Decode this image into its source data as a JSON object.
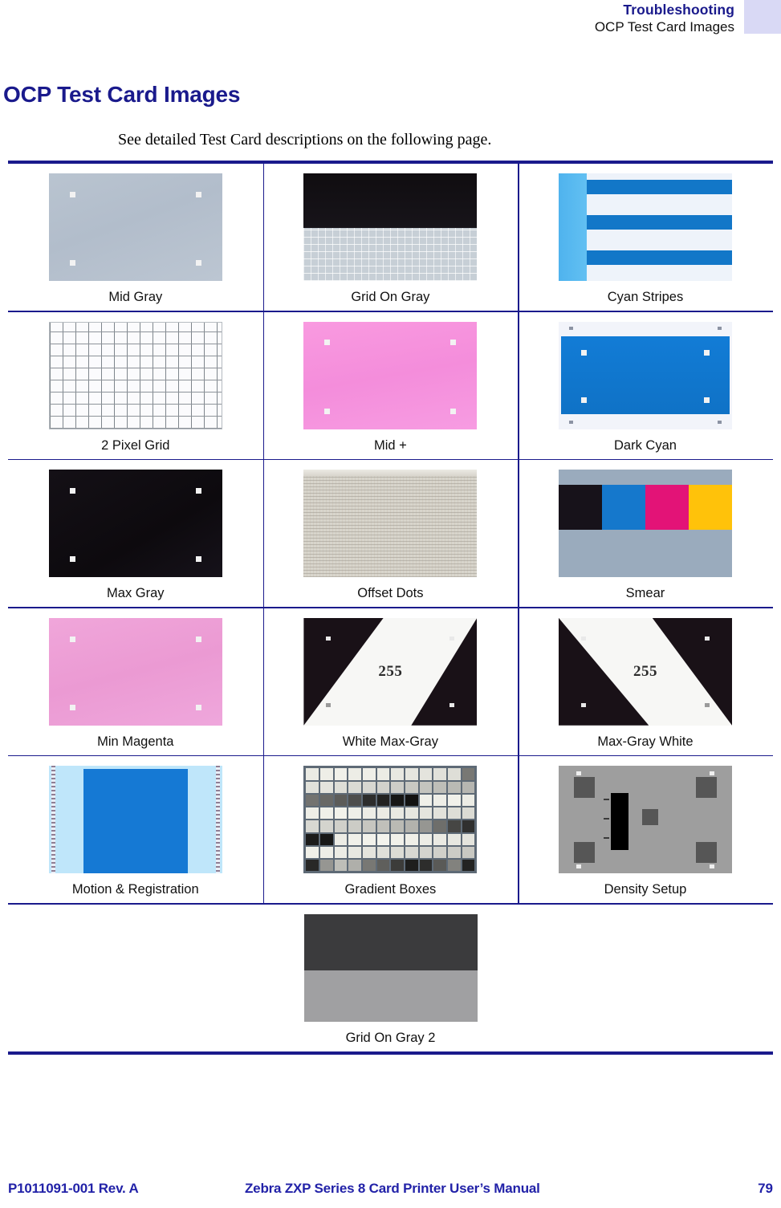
{
  "header": {
    "chapter": "Troubleshooting",
    "section": "OCP Test Card Images"
  },
  "page_title": "OCP Test Card Images",
  "intro": "See detailed Test Card descriptions on the following page.",
  "table": {
    "rows": [
      [
        {
          "caption": "Mid Gray",
          "art": "midgray"
        },
        {
          "caption": "Grid On Gray",
          "art": "gridongray"
        },
        {
          "caption": "Cyan Stripes",
          "art": "cyanstripes"
        }
      ],
      [
        {
          "caption": "2 Pixel Grid",
          "art": "2pxgrid"
        },
        {
          "caption": "Mid +",
          "art": "midplus"
        },
        {
          "caption": "Dark Cyan",
          "art": "darkcyan"
        }
      ],
      [
        {
          "caption": "Max Gray",
          "art": "maxgray"
        },
        {
          "caption": "Offset Dots",
          "art": "offsetdots"
        },
        {
          "caption": "Smear",
          "art": "smear"
        }
      ],
      [
        {
          "caption": "Min Magenta",
          "art": "minmagenta"
        },
        {
          "caption": "White Max-Gray",
          "art": "whitemaxgray",
          "value": "255"
        },
        {
          "caption": "Max-Gray White",
          "art": "maxgraywhite",
          "value": "255"
        }
      ],
      [
        {
          "caption": "Motion & Registration",
          "art": "motion"
        },
        {
          "caption": "Gradient Boxes",
          "art": "gradboxes"
        },
        {
          "caption": "Density Setup",
          "art": "density"
        }
      ],
      [
        {
          "caption": "Grid On Gray 2",
          "art": "gridongray2"
        }
      ]
    ]
  },
  "smear_blocks": [
    "#17121a",
    "#1578cc",
    "#e31377",
    "#ffc20a"
  ],
  "colors": {
    "rule": "#1a1a8c",
    "heading": "#1a1a8c",
    "footer_text": "#2222a8",
    "header_tab": "#d9d9f5"
  },
  "footer": {
    "part_number": "P1011091-001 Rev. A",
    "manual_title": "Zebra ZXP Series 8 Card Printer User’s Manual",
    "page_number": "79"
  }
}
